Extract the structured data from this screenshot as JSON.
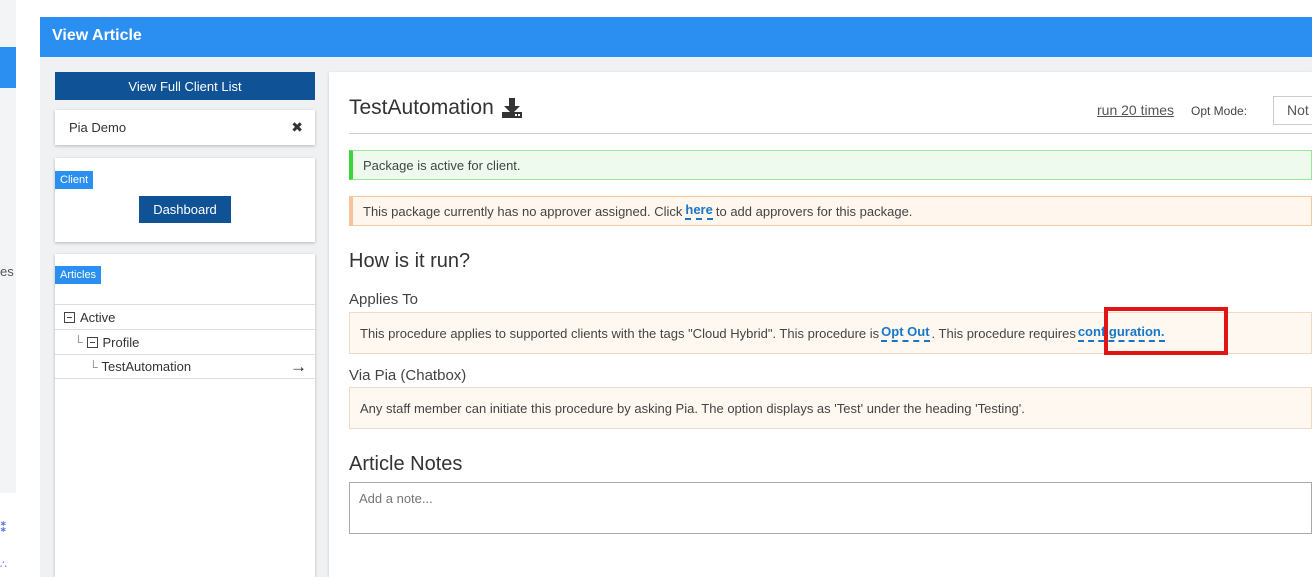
{
  "header": {
    "title": "View Article"
  },
  "left_strip": {
    "fragment_text": "es",
    "fragment_icon": "⁑",
    "fragment_icon2": "∴"
  },
  "sidebar": {
    "view_full_list_label": "View Full Client List",
    "client_name": "Pia Demo",
    "close_glyph": "✖",
    "client_tag": "Client",
    "dashboard_label": "Dashboard",
    "articles_tag": "Articles",
    "tree": [
      {
        "label": "Active"
      },
      {
        "label": "Profile"
      },
      {
        "label": "TestAutomation"
      }
    ],
    "tree_arrow": "→"
  },
  "article": {
    "title": "TestAutomation",
    "run_link": "run 20 times",
    "opt_mode_label": "Opt Mode:",
    "opt_mode_value": "Not",
    "alert_active": "Package is active for client.",
    "alert_approver_before": "This package currently has no approver assigned. Click",
    "alert_approver_link": "here",
    "alert_approver_after": "to add approvers for this package.",
    "how_heading": "How is it run?",
    "applies_to_label": "Applies To",
    "applies_text_1": "This procedure applies to supported clients with the tags \"Cloud Hybrid\". This procedure is",
    "applies_link_opt": "Opt Out",
    "applies_text_2": ". This procedure requires",
    "applies_link_config": "configuration.",
    "via_pia_label": "Via Pia (Chatbox)",
    "via_pia_text": "Any staff member can initiate this procedure by asking Pia. The option displays as 'Test' under the heading 'Testing'.",
    "notes_heading": "Article Notes",
    "notes_placeholder": "Add a note..."
  },
  "colors": {
    "header_blue": "#2a8ff0",
    "button_navy": "#0f5296",
    "link_blue": "#1677c9",
    "success_green": "#3bd43b",
    "warning_orange": "#f8c39a",
    "highlight_red": "#e01616"
  }
}
